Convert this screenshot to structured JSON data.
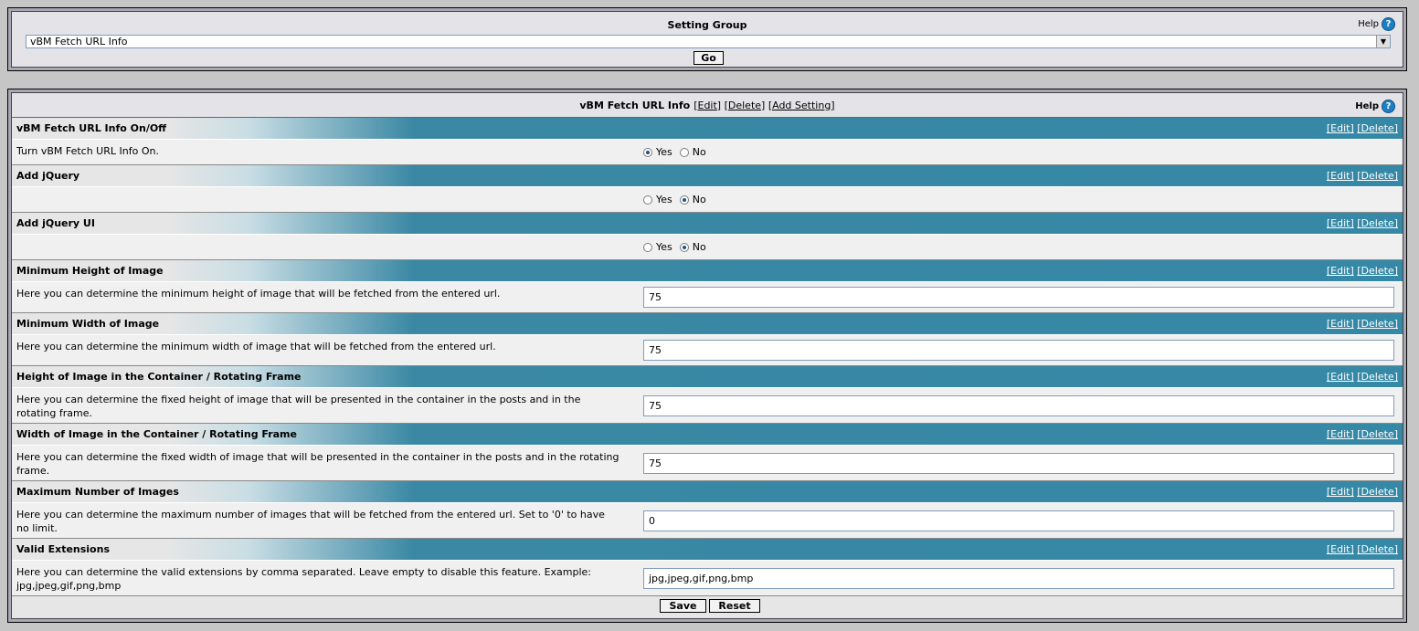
{
  "setting_group": {
    "title": "Setting Group",
    "help_label": "Help",
    "help_icon": "?",
    "selected": "vBM Fetch URL Info",
    "go_label": "Go"
  },
  "settings_panel": {
    "title": "vBM Fetch URL Info",
    "edit_link": "[Edit]",
    "delete_link": "[Delete]",
    "add_setting_link": "[Add Setting]",
    "help_label": "Help",
    "help_icon": "?"
  },
  "row_links": {
    "edit": "[Edit]",
    "delete": "[Delete]"
  },
  "radio_labels": {
    "yes": "Yes",
    "no": "No"
  },
  "sections": [
    {
      "title": "vBM Fetch URL Info On/Off",
      "description": "Turn vBM Fetch URL Info On.",
      "type": "radio",
      "value": "yes"
    },
    {
      "title": "Add jQuery",
      "description": "",
      "type": "radio",
      "value": "no"
    },
    {
      "title": "Add jQuery UI",
      "description": "",
      "type": "radio",
      "value": "no"
    },
    {
      "title": "Minimum Height of Image",
      "description": "Here you can determine the minimum height of image that will be fetched from the entered url.",
      "type": "text",
      "value": "75"
    },
    {
      "title": "Minimum Width of Image",
      "description": "Here you can determine the minimum width of image that will be fetched from the entered url.",
      "type": "text",
      "value": "75"
    },
    {
      "title": "Height of Image in the Container / Rotating Frame",
      "description": "Here you can determine the fixed height of image that will be presented in the container in the posts and in the rotating frame.",
      "type": "text",
      "value": "75"
    },
    {
      "title": "Width of Image in the Container / Rotating Frame",
      "description": "Here you can determine the fixed width of image that will be presented in the container in the posts and in the rotating frame.",
      "type": "text",
      "value": "75"
    },
    {
      "title": "Maximum Number of Images",
      "description": "Here you can determine the maximum number of images that will be fetched from the entered url. Set to '0' to have no limit.",
      "type": "text",
      "value": "0"
    },
    {
      "title": "Valid Extensions",
      "description": "Here you can determine the valid extensions by comma separated. Leave empty to disable this feature. Example: jpg,jpeg,gif,png,bmp",
      "type": "text",
      "value": "jpg,jpeg,gif,png,bmp"
    }
  ],
  "footer": {
    "save_label": "Save",
    "reset_label": "Reset"
  }
}
